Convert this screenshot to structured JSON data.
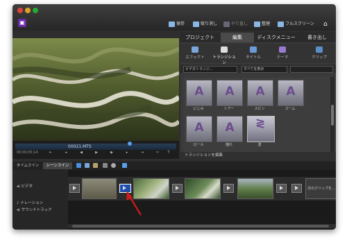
{
  "toolbar": {
    "save": "保存",
    "undo": "取り消し",
    "redo": "やり直し",
    "organize": "整理",
    "fullscreen": "フルスクリーン"
  },
  "main_tabs": [
    "プロジェクト",
    "編集",
    "ディスクメニュー",
    "書き出し"
  ],
  "active_main_tab": "編集",
  "sub_tabs": [
    "エフェクト",
    "トランジション",
    "タイトル",
    "テーマ",
    "クリップ"
  ],
  "active_sub_tab": "トランジション",
  "filters": {
    "category": "ビデオトランジ...",
    "show": "すべてを表示"
  },
  "transitions": [
    {
      "label": "にじみ",
      "glyph": "A"
    },
    {
      "label": "シアー",
      "glyph": "A"
    },
    {
      "label": "スピン",
      "glyph": "A"
    },
    {
      "label": "ズーム",
      "glyph": "A"
    },
    {
      "label": "ロール",
      "glyph": "A"
    },
    {
      "label": "揺れ",
      "glyph": "A"
    },
    {
      "label": "波",
      "glyph": "≷"
    }
  ],
  "apply_transition_label": "トランジションを編集",
  "preview": {
    "clip_name": "00021.MTS",
    "timecode": "00;00;05;14"
  },
  "timeline": {
    "tabs": [
      "タイムライン",
      "シーンライン"
    ],
    "active_tab": "シーンライン",
    "tracks": {
      "video": "ビデオ",
      "narration": "ナレーション",
      "soundtrack": "サウンドトラック"
    },
    "next_clip_label": "次のクリップを..."
  },
  "colors": {
    "accent": "#1c4fb0",
    "annotation_arrow": "#d11a1a",
    "app_icon": "#6a2aa8"
  }
}
